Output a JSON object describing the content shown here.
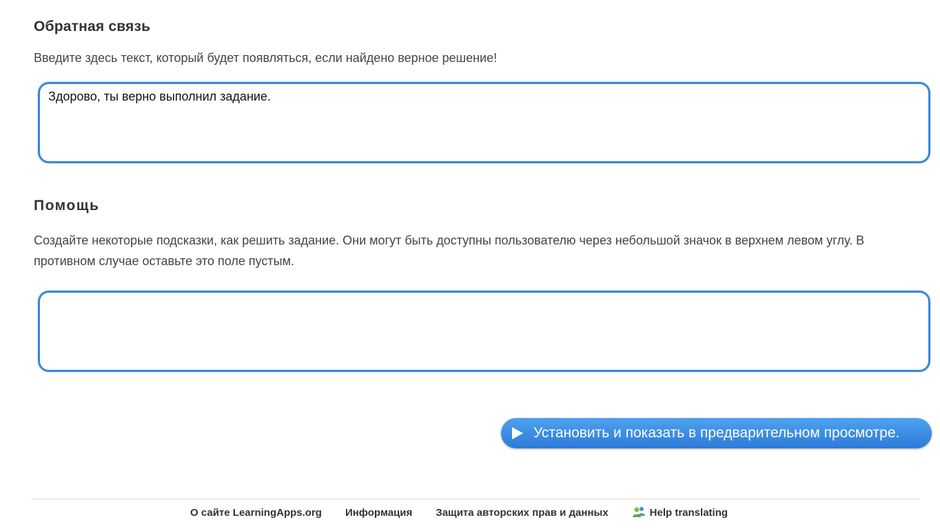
{
  "feedback": {
    "title": "Обратная связь",
    "description": "Введите здесь текст, который будет появляться, если найдено верное решение!",
    "value": "Здорово, ты верно выполнил задание."
  },
  "help": {
    "title": "Помощь",
    "description": "Создайте некоторые подсказки, как решить задание. Они могут быть доступны пользователю через небольшой значок в верхнем левом углу. В противном случае оставьте это поле пустым.",
    "value": ""
  },
  "actions": {
    "preview_label": "Установить и показать в предварительном просмотре.",
    "preview_icon": "play-icon"
  },
  "footer": {
    "links": [
      {
        "label": "О сайте LearningApps.org"
      },
      {
        "label": "Информация"
      },
      {
        "label": "Защита авторских прав и данных"
      },
      {
        "label": "Help translating",
        "icon": "translate-people-icon"
      }
    ]
  },
  "colors": {
    "accent": "#3a87d6",
    "button": "#2d7ad8",
    "text": "#333333"
  }
}
